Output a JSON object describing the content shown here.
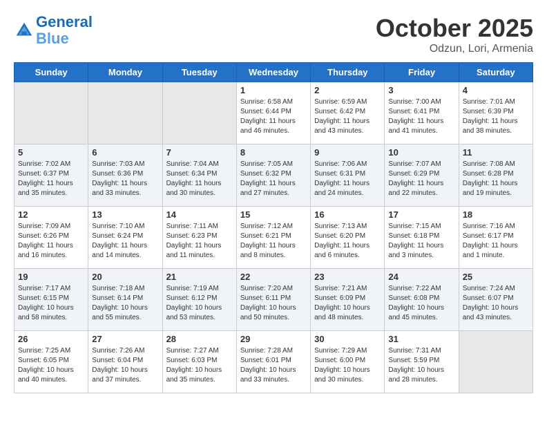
{
  "header": {
    "logo_line1": "General",
    "logo_line2": "Blue",
    "month": "October 2025",
    "location": "Odzun, Lori, Armenia"
  },
  "weekdays": [
    "Sunday",
    "Monday",
    "Tuesday",
    "Wednesday",
    "Thursday",
    "Friday",
    "Saturday"
  ],
  "weeks": [
    [
      {
        "day": "",
        "sunrise": "",
        "sunset": "",
        "daylight": "",
        "empty": true
      },
      {
        "day": "",
        "sunrise": "",
        "sunset": "",
        "daylight": "",
        "empty": true
      },
      {
        "day": "",
        "sunrise": "",
        "sunset": "",
        "daylight": "",
        "empty": true
      },
      {
        "day": "1",
        "sunrise": "Sunrise: 6:58 AM",
        "sunset": "Sunset: 6:44 PM",
        "daylight": "Daylight: 11 hours and 46 minutes."
      },
      {
        "day": "2",
        "sunrise": "Sunrise: 6:59 AM",
        "sunset": "Sunset: 6:42 PM",
        "daylight": "Daylight: 11 hours and 43 minutes."
      },
      {
        "day": "3",
        "sunrise": "Sunrise: 7:00 AM",
        "sunset": "Sunset: 6:41 PM",
        "daylight": "Daylight: 11 hours and 41 minutes."
      },
      {
        "day": "4",
        "sunrise": "Sunrise: 7:01 AM",
        "sunset": "Sunset: 6:39 PM",
        "daylight": "Daylight: 11 hours and 38 minutes."
      }
    ],
    [
      {
        "day": "5",
        "sunrise": "Sunrise: 7:02 AM",
        "sunset": "Sunset: 6:37 PM",
        "daylight": "Daylight: 11 hours and 35 minutes."
      },
      {
        "day": "6",
        "sunrise": "Sunrise: 7:03 AM",
        "sunset": "Sunset: 6:36 PM",
        "daylight": "Daylight: 11 hours and 33 minutes."
      },
      {
        "day": "7",
        "sunrise": "Sunrise: 7:04 AM",
        "sunset": "Sunset: 6:34 PM",
        "daylight": "Daylight: 11 hours and 30 minutes."
      },
      {
        "day": "8",
        "sunrise": "Sunrise: 7:05 AM",
        "sunset": "Sunset: 6:32 PM",
        "daylight": "Daylight: 11 hours and 27 minutes."
      },
      {
        "day": "9",
        "sunrise": "Sunrise: 7:06 AM",
        "sunset": "Sunset: 6:31 PM",
        "daylight": "Daylight: 11 hours and 24 minutes."
      },
      {
        "day": "10",
        "sunrise": "Sunrise: 7:07 AM",
        "sunset": "Sunset: 6:29 PM",
        "daylight": "Daylight: 11 hours and 22 minutes."
      },
      {
        "day": "11",
        "sunrise": "Sunrise: 7:08 AM",
        "sunset": "Sunset: 6:28 PM",
        "daylight": "Daylight: 11 hours and 19 minutes."
      }
    ],
    [
      {
        "day": "12",
        "sunrise": "Sunrise: 7:09 AM",
        "sunset": "Sunset: 6:26 PM",
        "daylight": "Daylight: 11 hours and 16 minutes."
      },
      {
        "day": "13",
        "sunrise": "Sunrise: 7:10 AM",
        "sunset": "Sunset: 6:24 PM",
        "daylight": "Daylight: 11 hours and 14 minutes."
      },
      {
        "day": "14",
        "sunrise": "Sunrise: 7:11 AM",
        "sunset": "Sunset: 6:23 PM",
        "daylight": "Daylight: 11 hours and 11 minutes."
      },
      {
        "day": "15",
        "sunrise": "Sunrise: 7:12 AM",
        "sunset": "Sunset: 6:21 PM",
        "daylight": "Daylight: 11 hours and 8 minutes."
      },
      {
        "day": "16",
        "sunrise": "Sunrise: 7:13 AM",
        "sunset": "Sunset: 6:20 PM",
        "daylight": "Daylight: 11 hours and 6 minutes."
      },
      {
        "day": "17",
        "sunrise": "Sunrise: 7:15 AM",
        "sunset": "Sunset: 6:18 PM",
        "daylight": "Daylight: 11 hours and 3 minutes."
      },
      {
        "day": "18",
        "sunrise": "Sunrise: 7:16 AM",
        "sunset": "Sunset: 6:17 PM",
        "daylight": "Daylight: 11 hours and 1 minute."
      }
    ],
    [
      {
        "day": "19",
        "sunrise": "Sunrise: 7:17 AM",
        "sunset": "Sunset: 6:15 PM",
        "daylight": "Daylight: 10 hours and 58 minutes."
      },
      {
        "day": "20",
        "sunrise": "Sunrise: 7:18 AM",
        "sunset": "Sunset: 6:14 PM",
        "daylight": "Daylight: 10 hours and 55 minutes."
      },
      {
        "day": "21",
        "sunrise": "Sunrise: 7:19 AM",
        "sunset": "Sunset: 6:12 PM",
        "daylight": "Daylight: 10 hours and 53 minutes."
      },
      {
        "day": "22",
        "sunrise": "Sunrise: 7:20 AM",
        "sunset": "Sunset: 6:11 PM",
        "daylight": "Daylight: 10 hours and 50 minutes."
      },
      {
        "day": "23",
        "sunrise": "Sunrise: 7:21 AM",
        "sunset": "Sunset: 6:09 PM",
        "daylight": "Daylight: 10 hours and 48 minutes."
      },
      {
        "day": "24",
        "sunrise": "Sunrise: 7:22 AM",
        "sunset": "Sunset: 6:08 PM",
        "daylight": "Daylight: 10 hours and 45 minutes."
      },
      {
        "day": "25",
        "sunrise": "Sunrise: 7:24 AM",
        "sunset": "Sunset: 6:07 PM",
        "daylight": "Daylight: 10 hours and 43 minutes."
      }
    ],
    [
      {
        "day": "26",
        "sunrise": "Sunrise: 7:25 AM",
        "sunset": "Sunset: 6:05 PM",
        "daylight": "Daylight: 10 hours and 40 minutes."
      },
      {
        "day": "27",
        "sunrise": "Sunrise: 7:26 AM",
        "sunset": "Sunset: 6:04 PM",
        "daylight": "Daylight: 10 hours and 37 minutes."
      },
      {
        "day": "28",
        "sunrise": "Sunrise: 7:27 AM",
        "sunset": "Sunset: 6:03 PM",
        "daylight": "Daylight: 10 hours and 35 minutes."
      },
      {
        "day": "29",
        "sunrise": "Sunrise: 7:28 AM",
        "sunset": "Sunset: 6:01 PM",
        "daylight": "Daylight: 10 hours and 33 minutes."
      },
      {
        "day": "30",
        "sunrise": "Sunrise: 7:29 AM",
        "sunset": "Sunset: 6:00 PM",
        "daylight": "Daylight: 10 hours and 30 minutes."
      },
      {
        "day": "31",
        "sunrise": "Sunrise: 7:31 AM",
        "sunset": "Sunset: 5:59 PM",
        "daylight": "Daylight: 10 hours and 28 minutes."
      },
      {
        "day": "",
        "sunrise": "",
        "sunset": "",
        "daylight": "",
        "empty": true
      }
    ]
  ]
}
